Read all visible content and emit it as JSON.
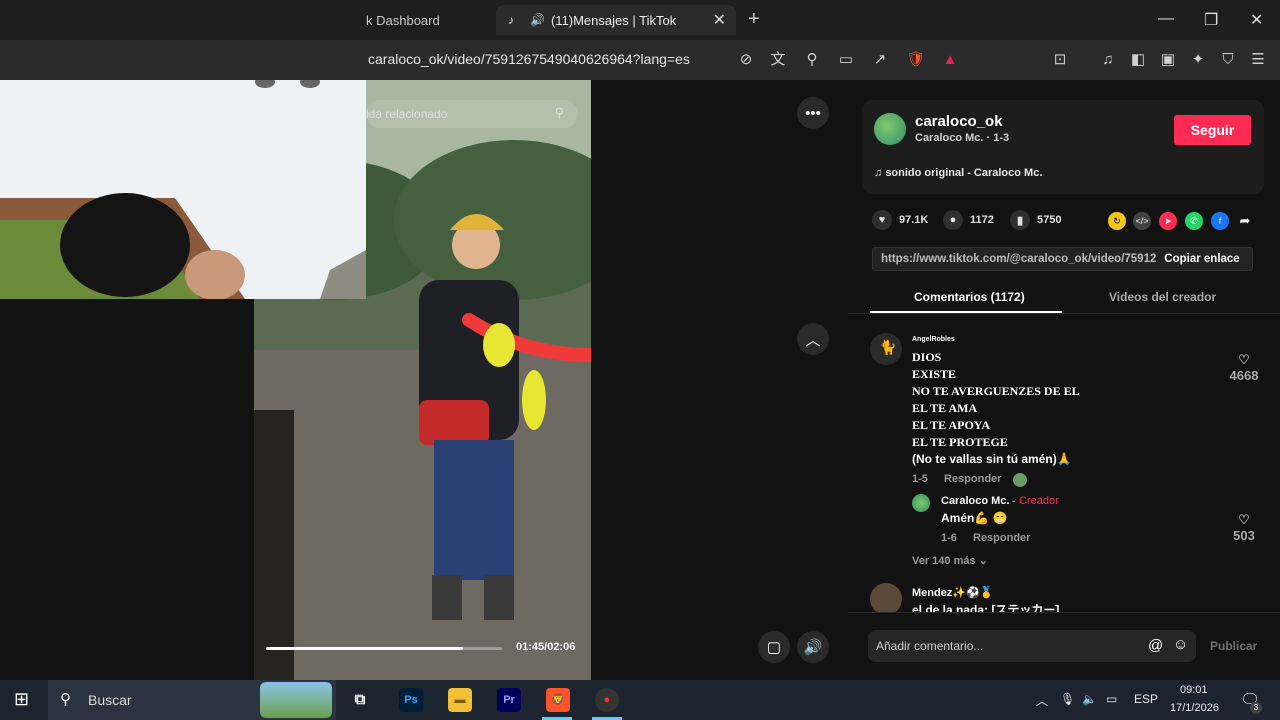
{
  "browser": {
    "tabs": [
      {
        "label": "k Dashboard"
      },
      {
        "label": "(11)Mensajes | TikTok"
      }
    ],
    "url": "caraloco_ok/video/7591267549040626964?lang=es"
  },
  "video": {
    "search_placeholder": "ida relacionado",
    "time": "01:45/02:06",
    "progress": 0.833
  },
  "creator": {
    "handle": "caraloco_ok",
    "subline": "Caraloco Mc. · 1-3",
    "follow_label": "Seguir",
    "sound": "sonido original - Caraloco Mc."
  },
  "stats": {
    "likes": "97.1K",
    "comments": "1172",
    "saves": "5750"
  },
  "link": {
    "url": "https://www.tiktok.com/@caraloco_ok/video/75912...",
    "copy_label": "Copiar enlace"
  },
  "panel_tabs": {
    "comments": "Comentarios (1172)",
    "creator_videos": "Videos del creador"
  },
  "comments": [
    {
      "user": "AngelRobles",
      "lines": [
        "DIOS",
        "EXISTE",
        "NO TE AVERGUENZES DE EL",
        "EL TE AMA",
        "EL TE APOYA",
        "EL TE PROTEGE",
        "(No te vallas sin tú amén)🙏"
      ],
      "date": "1-5",
      "reply_label": "Responder",
      "likes": "4668",
      "reply": {
        "user": "Caraloco Mc.",
        "tag": "Creador",
        "text": "Amén💪 😁",
        "date": "1-6",
        "reply_label": "Responder",
        "likes": "503"
      },
      "more": "Ver 140 más"
    },
    {
      "user": "Mendez✨⚽🥇",
      "text": "el de la nada: [ステッカー]"
    }
  ],
  "comment_input": {
    "placeholder": "Añadir comentario...",
    "publish_label": "Publicar"
  },
  "taskbar": {
    "search_label": "Buscar",
    "lang": "ESP",
    "time": "09:01",
    "date": "17/1/2026",
    "notif_count": "3"
  },
  "colors": {
    "accent": "#fe2c55",
    "background": "#121212"
  }
}
